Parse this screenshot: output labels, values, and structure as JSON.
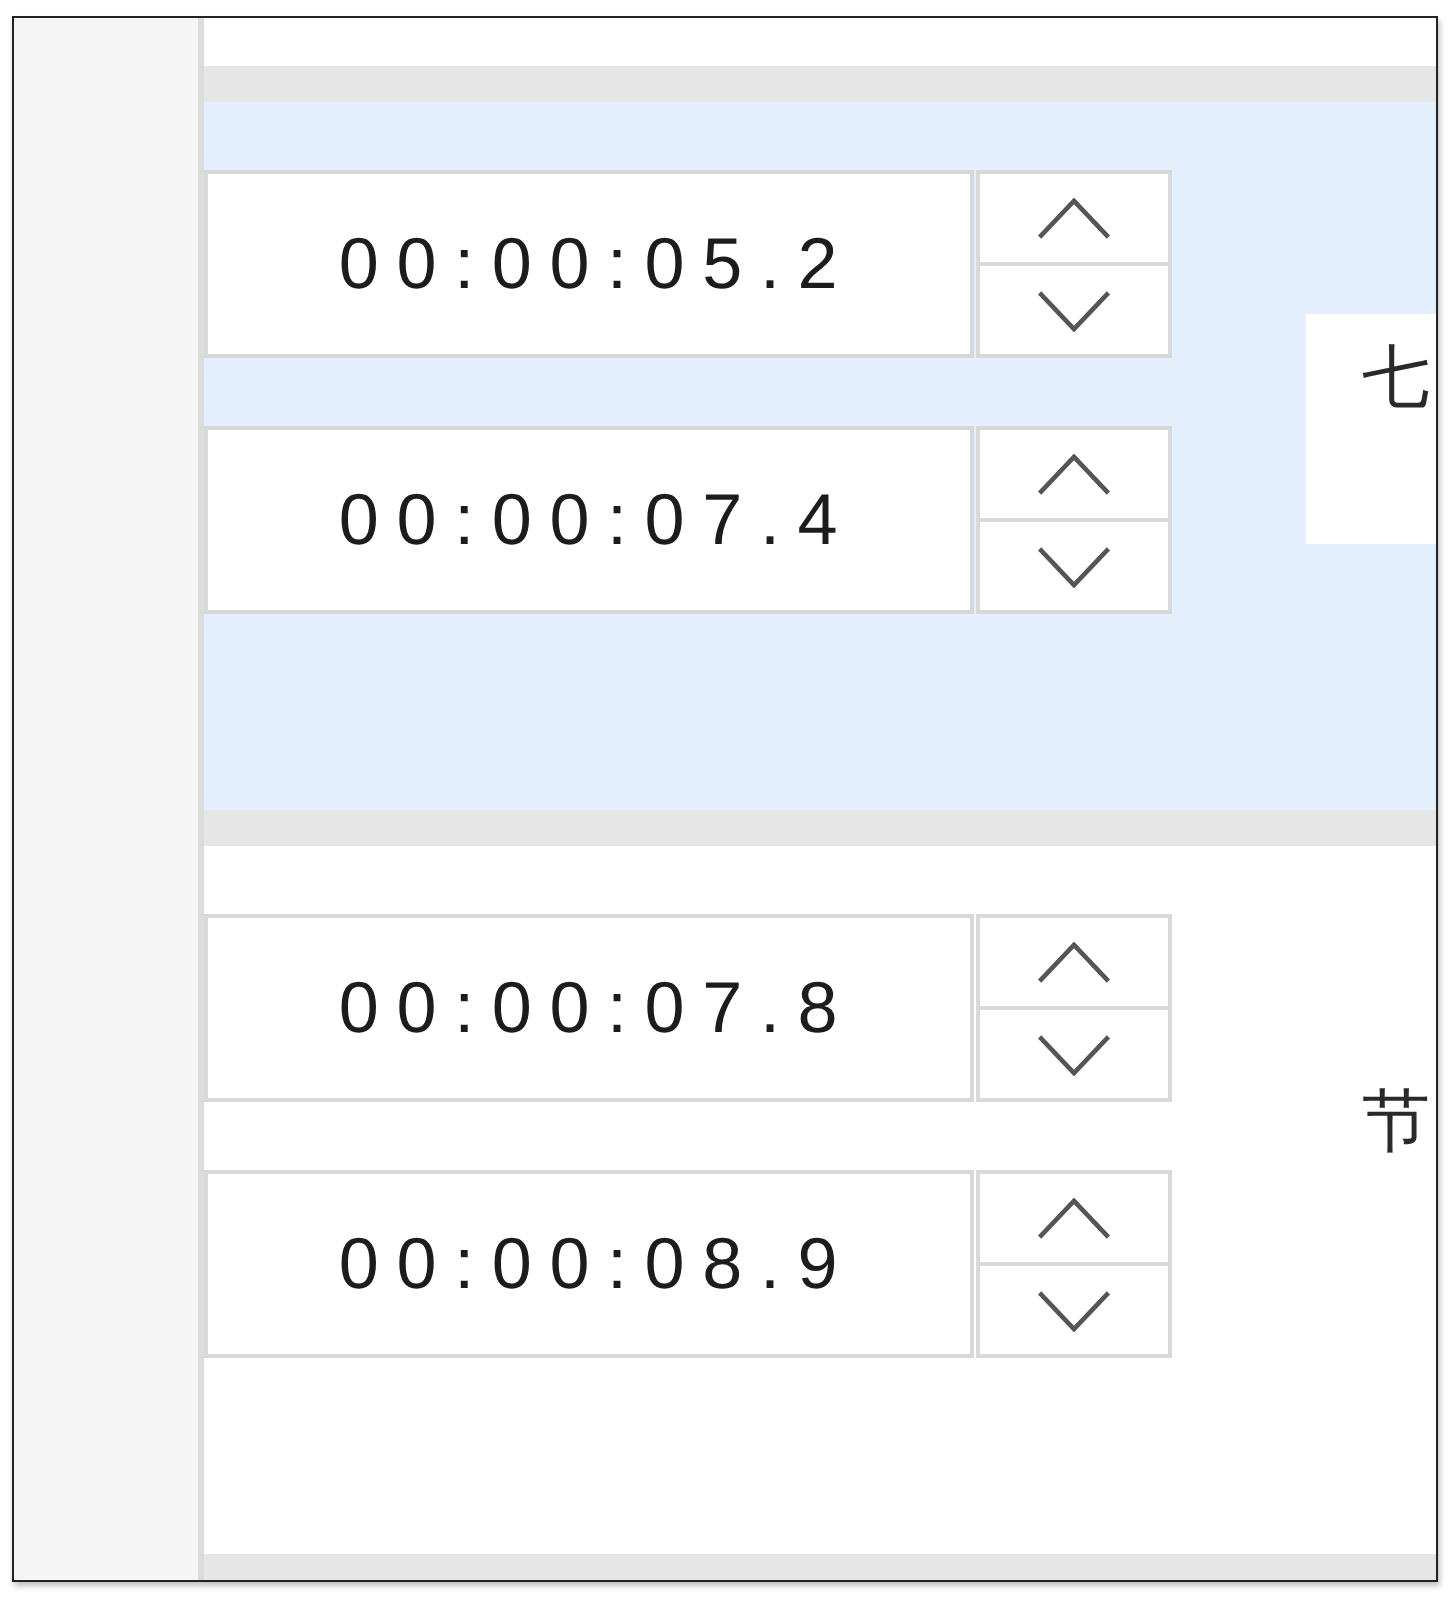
{
  "segments": [
    {
      "selected": true,
      "start_time": "00:00:05.2",
      "end_time": "00:00:07.4",
      "text": "七"
    },
    {
      "selected": false,
      "start_time": "00:00:07.8",
      "end_time": "00:00:08.9",
      "text": "节"
    }
  ]
}
